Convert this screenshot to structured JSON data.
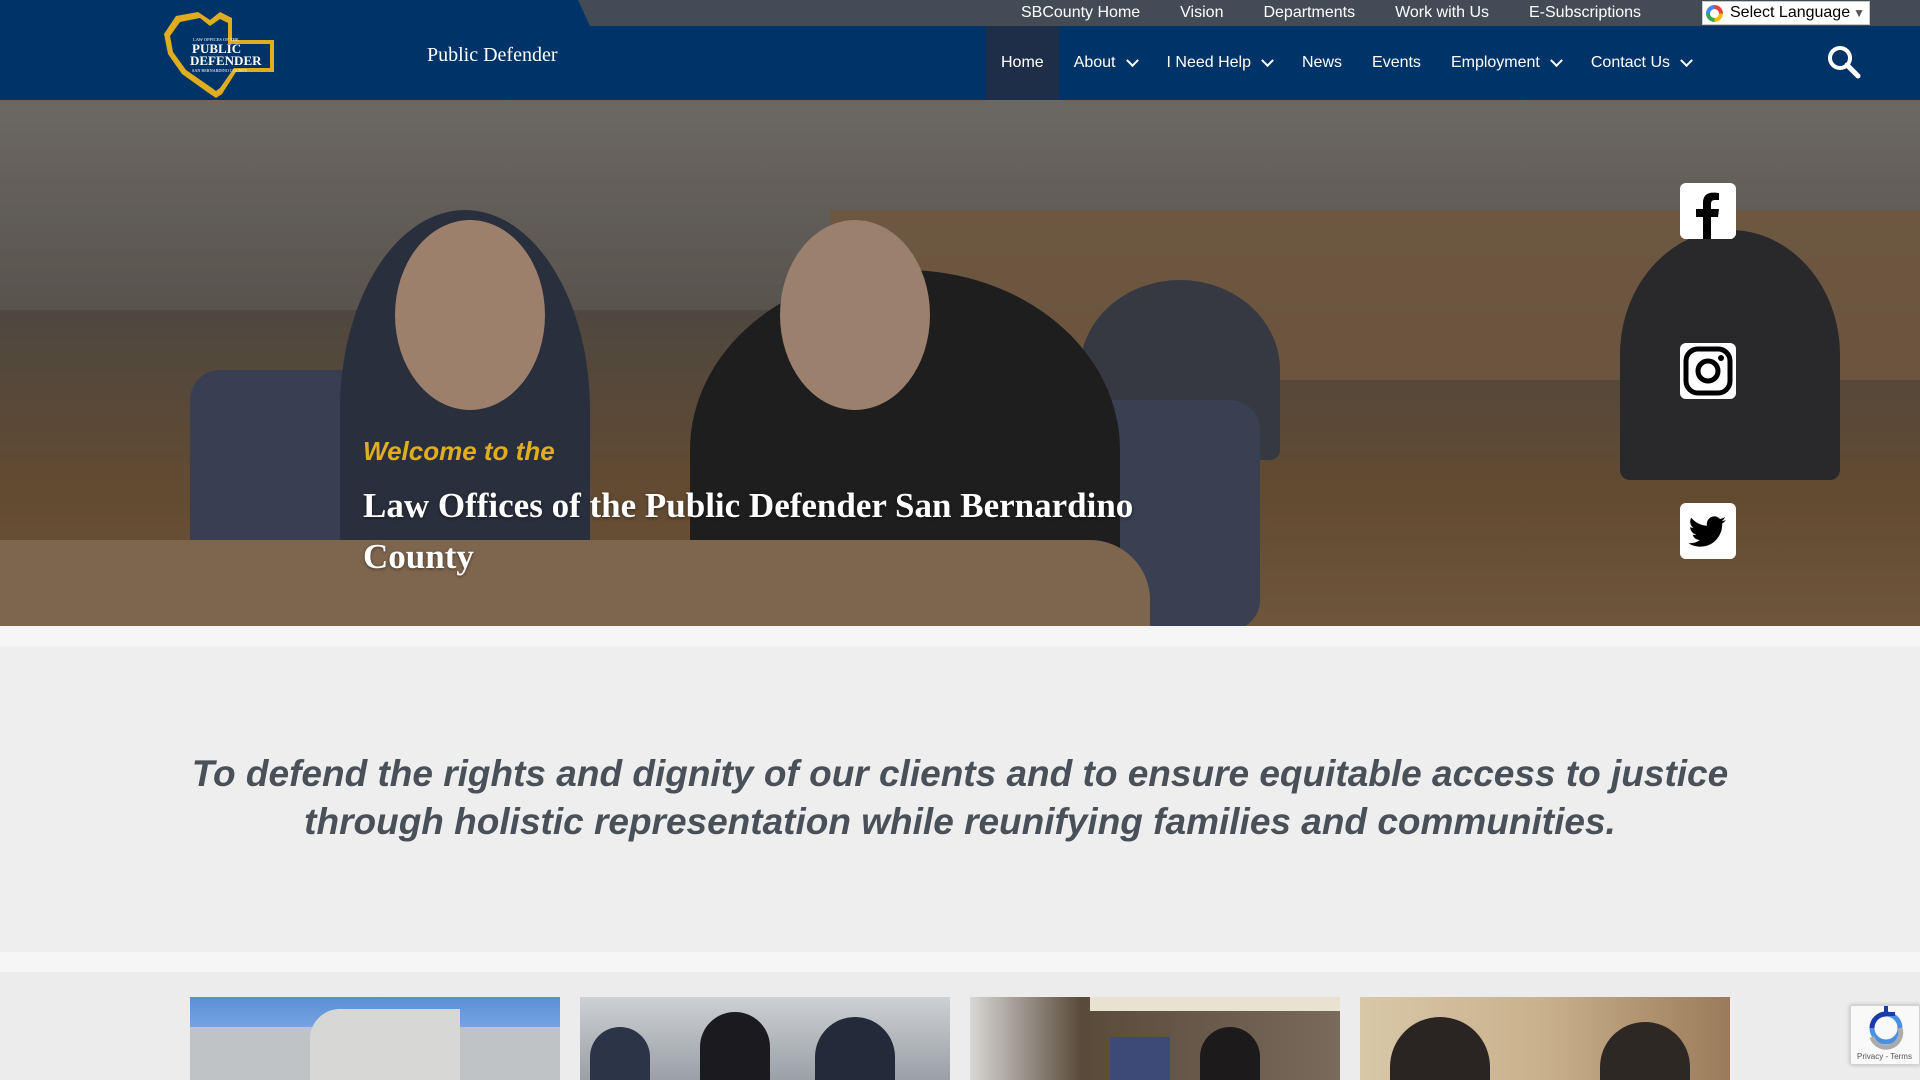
{
  "utility_nav": {
    "links": [
      "SBCounty Home",
      "Vision",
      "Departments",
      "Work with Us",
      "E-Subscriptions"
    ],
    "language_select": "Select Language"
  },
  "header": {
    "logo": {
      "line1": "LAW OFFICES OF THE",
      "line2": "PUBLIC",
      "line3": "DEFENDER",
      "line4": "SAN BERNARDINO COUNTY"
    },
    "site_name": "Public Defender",
    "nav": [
      {
        "label": "Home",
        "dropdown": false,
        "active": true
      },
      {
        "label": "About",
        "dropdown": true,
        "active": false
      },
      {
        "label": "I Need Help",
        "dropdown": true,
        "active": false
      },
      {
        "label": "News",
        "dropdown": false,
        "active": false
      },
      {
        "label": "Events",
        "dropdown": false,
        "active": false
      },
      {
        "label": "Employment",
        "dropdown": true,
        "active": false
      },
      {
        "label": "Contact Us",
        "dropdown": true,
        "active": false
      }
    ]
  },
  "hero": {
    "welcome": "Welcome to the",
    "title": "Law Offices of the Public Defender San Bernardino County",
    "social": [
      "facebook-icon",
      "instagram-icon",
      "twitter-icon"
    ]
  },
  "mission": {
    "text": "To defend the rights and dignity of our clients and to ensure equitable access to justice through holistic representation while reunifying families and communities."
  },
  "recaptcha": {
    "links": "Privacy - Terms"
  },
  "colors": {
    "navy": "#003468",
    "utility_bar": "#434b57",
    "gold": "#e0ad1e",
    "mission_text": "#4a5058"
  }
}
